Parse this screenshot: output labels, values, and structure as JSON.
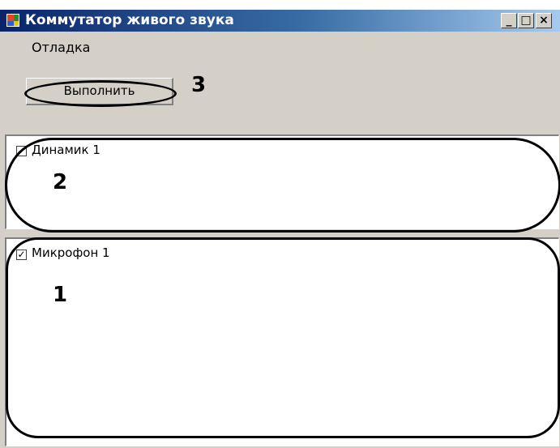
{
  "window": {
    "title": "Коммутатор живого звука",
    "controls": {
      "minimize": "_",
      "maximize": "□",
      "close": "×"
    }
  },
  "menu": {
    "items": [
      {
        "label": "Отладка"
      }
    ]
  },
  "toolbar": {
    "run_label": "Выполнить"
  },
  "panels": [
    {
      "checkbox_label": "Динамик 1",
      "checked": true
    },
    {
      "checkbox_label": "Микрофон 1",
      "checked": true
    }
  ],
  "callouts": {
    "run_button": "3",
    "speaker_panel": "2",
    "mic_panel": "1"
  },
  "colors": {
    "titlebar_start": "#0a246a",
    "titlebar_end": "#a6caf0",
    "window_bg": "#d4d0c8",
    "panel_bg": "#ffffff",
    "callout_outline": "#000000"
  },
  "icons": {
    "app": "app-icon",
    "check": "check-icon"
  }
}
